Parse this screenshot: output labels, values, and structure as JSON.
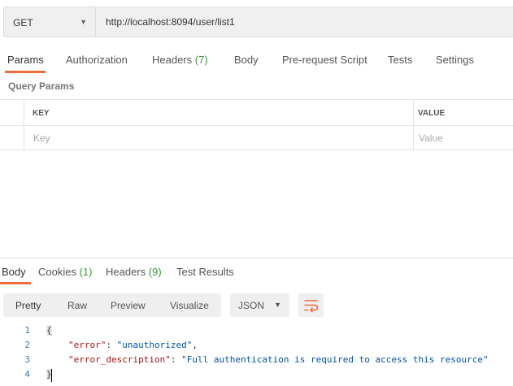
{
  "request": {
    "method": "GET",
    "url": "http://localhost:8094/user/list1"
  },
  "tabs": [
    {
      "label": "Params",
      "count": ""
    },
    {
      "label": "Authorization",
      "count": ""
    },
    {
      "label": "Headers",
      "count": "(7)"
    },
    {
      "label": "Body",
      "count": ""
    },
    {
      "label": "Pre-request Script",
      "count": ""
    },
    {
      "label": "Tests",
      "count": ""
    },
    {
      "label": "Settings",
      "count": ""
    }
  ],
  "active_tab": "Params",
  "query_params": {
    "title": "Query Params",
    "columns": [
      "KEY",
      "VALUE"
    ],
    "key_placeholder": "Key",
    "value_placeholder": "Value"
  },
  "response_tabs": [
    {
      "label": "Body",
      "count": ""
    },
    {
      "label": "Cookies",
      "count": "(1)"
    },
    {
      "label": "Headers",
      "count": "(9)"
    },
    {
      "label": "Test Results",
      "count": ""
    }
  ],
  "active_response_tab": "Body",
  "view_modes": [
    "Pretty",
    "Raw",
    "Preview",
    "Visualize"
  ],
  "active_view_mode": "Pretty",
  "format": "JSON",
  "code": {
    "line_numbers": [
      "1",
      "2",
      "3",
      "4"
    ],
    "open_brace": "{",
    "close_brace": "}",
    "lines": [
      {
        "key": "\"error\"",
        "sep": ": ",
        "value": "\"unauthorized\"",
        "trail": ","
      },
      {
        "key": "\"error_description\"",
        "sep": ": ",
        "value": "\"Full authentication is required to access this resource\"",
        "trail": ""
      }
    ]
  },
  "colors": {
    "accent": "#f26b3a",
    "count": "#3c9b3c",
    "json_key": "#a31515",
    "json_string": "#0451a5",
    "line_number": "#2c7fb8"
  },
  "icons": {
    "method_dropdown": "chevron-down-icon",
    "format_dropdown": "chevron-down-icon",
    "wrap": "wrap-lines-icon"
  }
}
